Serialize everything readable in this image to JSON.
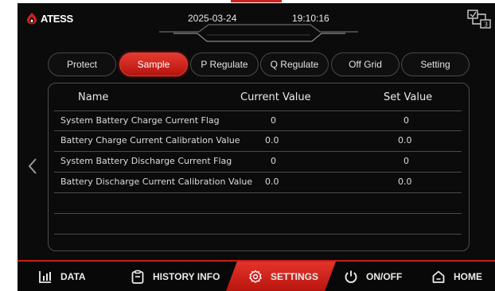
{
  "header": {
    "brand": "ATESS",
    "date": "2025-03-24",
    "time": "19:10:16"
  },
  "tabs": [
    {
      "label": "Protect",
      "active": false
    },
    {
      "label": "Sample",
      "active": true
    },
    {
      "label": "P Regulate",
      "active": false
    },
    {
      "label": "Q Regulate",
      "active": false
    },
    {
      "label": "Off Grid",
      "active": false
    },
    {
      "label": "Setting",
      "active": false
    }
  ],
  "table": {
    "columns": [
      "Name",
      "Current Value",
      "Set Value"
    ],
    "rows": [
      {
        "name": "System Battery Charge Current Flag",
        "current": "0",
        "set": "0"
      },
      {
        "name": "Battery Charge Current Calibration Value",
        "current": "0.0",
        "set": "0.0"
      },
      {
        "name": "System Battery Discharge Current Flag",
        "current": "0",
        "set": "0"
      },
      {
        "name": "Battery Discharge Current Calibration Value",
        "current": "0.0",
        "set": "0.0"
      }
    ]
  },
  "nav": [
    {
      "label": "DATA",
      "icon": "bar-chart-icon"
    },
    {
      "label": "HISTORY INFO",
      "icon": "clipboard-icon"
    },
    {
      "label": "SETTINGS",
      "icon": "gear-icon",
      "active": true
    },
    {
      "label": "ON/OFF",
      "icon": "power-icon"
    },
    {
      "label": "HOME",
      "icon": "home-icon"
    }
  ],
  "colors": {
    "accent": "#d0211c",
    "background": "#0b0b0b",
    "text": "#e2e2e2"
  }
}
